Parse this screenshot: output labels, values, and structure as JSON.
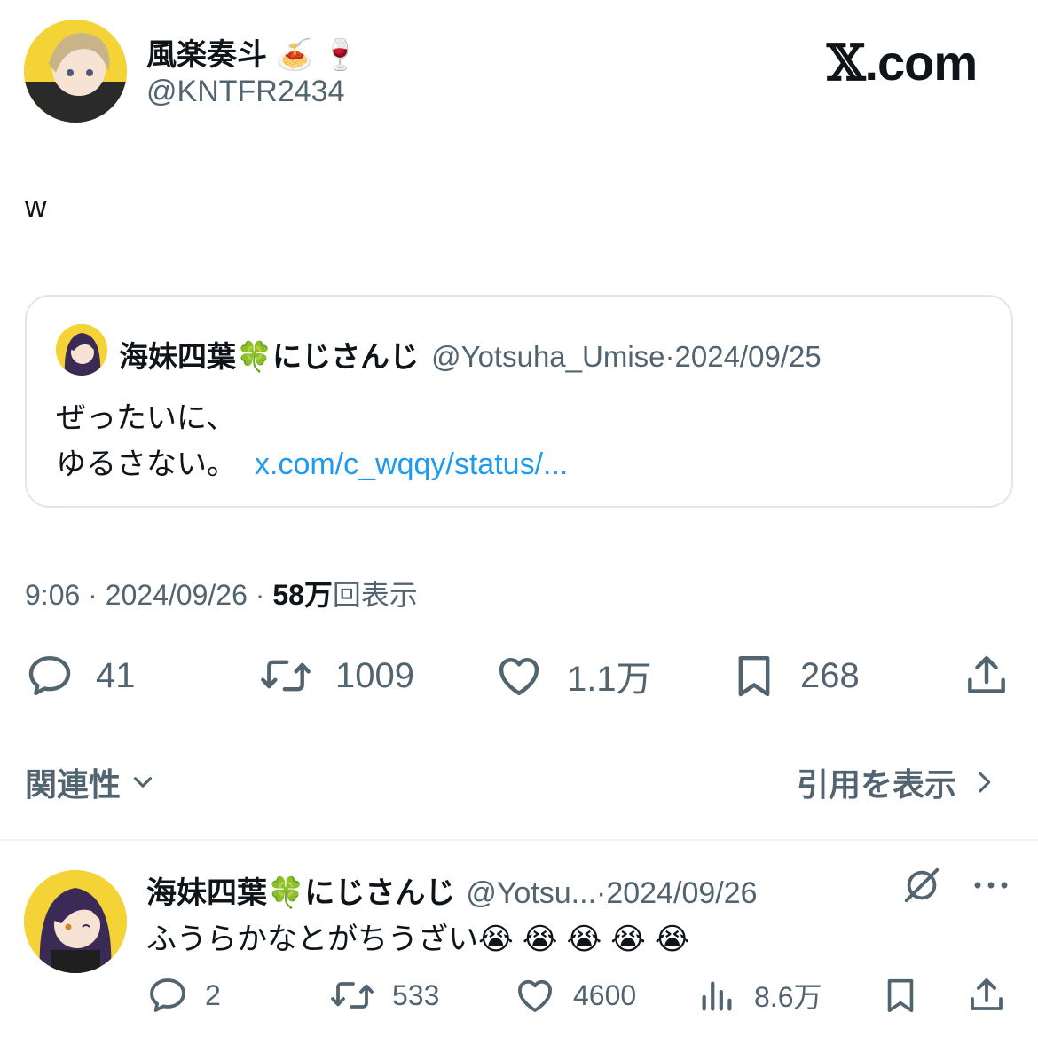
{
  "header": {
    "author_name": "風楽奏斗",
    "author_emojis": "🍝 🍷",
    "author_handle": "@KNTFR2434",
    "brand_x": "𝕏",
    "brand_suffix": ".com"
  },
  "tweet": {
    "text": "w",
    "time": "9:06",
    "date": "2024/09/26",
    "views_count": "58万",
    "views_label": "回表示",
    "separator": " · "
  },
  "quote": {
    "name": "海妹四葉",
    "name_emoji": "🍀",
    "name_suffix": "にじさんじ",
    "handle": "@Yotsuha_Umise",
    "separator": "·",
    "date": "2024/09/25",
    "line1": "ぜったいに、",
    "line2": "ゆるさない。",
    "link": "x.com/c_wqqy/status/..."
  },
  "actions": {
    "replies": "41",
    "retweets": "1009",
    "likes": "1.1万",
    "bookmarks": "268"
  },
  "sort": {
    "label": "関連性",
    "quotes_link": "引用を表示"
  },
  "reply": {
    "name": "海妹四葉",
    "name_emoji": "🍀",
    "name_suffix": "にじさんじ",
    "handle": "@Yotsu...",
    "separator": "·",
    "date": "2024/09/26",
    "text": "ふうらかなとがちうざい",
    "emojis": "😭😭😭😭😭",
    "replies": "2",
    "retweets": "533",
    "likes": "4600",
    "views": "8.6万"
  },
  "colors": {
    "text_primary": "#0f1419",
    "text_secondary": "#536471",
    "link": "#1d9bf0",
    "border": "#e1e6ea"
  }
}
